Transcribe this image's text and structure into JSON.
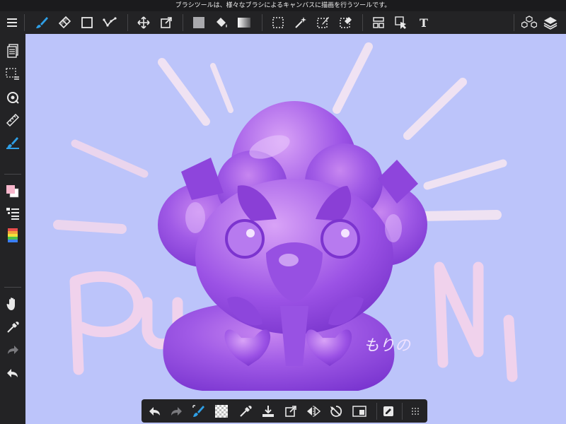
{
  "tooltip": {
    "text": "ブラシツールは、様々なブラシによるキャンバスに描画を行うツールです。"
  },
  "colors": {
    "toolbar_bg": "#232325",
    "canvas_bg": "#bcc4fa",
    "accent": "#2f9fe6",
    "icon": "#e8e8e8",
    "foreground_color": "#f7b6cc",
    "background_color": "#ffffff"
  },
  "top_toolbar": {
    "items": [
      "menu-icon",
      "brush-tool",
      "eraser-tool",
      "shape-tool",
      "correction-tool",
      "move-tool",
      "transform-tool",
      "fill-color",
      "bucket-tool",
      "gradation-tool",
      "select-tool",
      "magic-wand-tool",
      "select-pen-tool",
      "select-eraser-tool",
      "panel-layout-tool",
      "object-tool",
      "text-tool",
      "3d-material-icon",
      "layers-icon"
    ],
    "text_tool_label": "T",
    "active": "brush-tool"
  },
  "left_sidebar": {
    "items": [
      "page-manager-icon",
      "selection-icon",
      "navigator-icon",
      "ruler-icon",
      "brush-settings-icon",
      "color-icon",
      "layer-properties-icon",
      "color-palette-icon",
      "hand-icon",
      "eyedropper-icon",
      "redo-icon",
      "undo-icon"
    ]
  },
  "canvas": {
    "artwork": "Purple jelly character illustration",
    "signature": "もりの",
    "lettering": "PuNi"
  },
  "bottom_toolbar": {
    "items": [
      "undo-icon",
      "redo-icon",
      "brush-swap-icon",
      "transparent-color-icon",
      "eyedropper-icon",
      "save-icon",
      "transform-icon",
      "flip-horizontal-icon",
      "rotate-reset-icon",
      "fit-screen-icon",
      "edit-icon",
      "more-icon"
    ]
  }
}
